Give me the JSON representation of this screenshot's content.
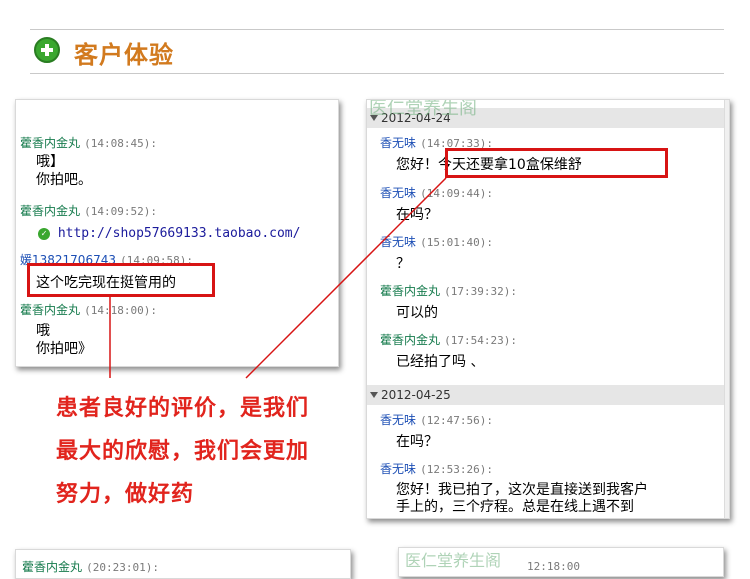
{
  "header": {
    "title": "客户体验",
    "icon": "plus-icon"
  },
  "left_shot": {
    "entries": [
      {
        "sender": "藿香内金丸",
        "time": "(14:08:45):",
        "lines": [
          "哦】",
          "你拍吧。"
        ]
      },
      {
        "sender": "藿香内金丸",
        "time": "(14:09:52):",
        "link": "http://shop57669133.taobao.com/"
      },
      {
        "sender": "媛13821706743",
        "time": "(14:09:58):",
        "lines": [
          "这个吃完现在挺管用的"
        ]
      },
      {
        "sender": "藿香内金丸",
        "time": "(14:18:00):",
        "lines": [
          "哦",
          "你拍吧》"
        ]
      }
    ]
  },
  "right_shot": {
    "watermark": "医仁堂养生阁",
    "date1": "2012-04-24",
    "entries1": [
      {
        "sender": "香无味",
        "time": "(14:07:33):",
        "line": "您好！今天还要拿10盒保维舒"
      },
      {
        "sender": "香无味",
        "time": "(14:09:44):",
        "line": "在吗？"
      },
      {
        "sender": "香无味",
        "time": "(15:01:40):",
        "line": "？"
      },
      {
        "sender": "藿香内金丸",
        "time": "(17:39:32):",
        "line": "可以的"
      },
      {
        "sender": "藿香内金丸",
        "time": "(17:54:23):",
        "line": "已经拍了吗 、"
      }
    ],
    "date2": "2012-04-25",
    "entries2": [
      {
        "sender": "香无味",
        "time": "(12:47:56):",
        "line": "在吗？"
      },
      {
        "sender": "香无味",
        "time": "(12:53:26):",
        "lines": [
          "您好！我已拍了，这次是直接送到我客户",
          "手上的，三个疗程。总是在线上遇不到"
        ]
      }
    ]
  },
  "caption": {
    "lines": [
      "患者良好的评价，是我们",
      "最大的欣慰，我们会更加",
      "努力，做好药"
    ]
  },
  "bottom_left": {
    "sender": "藿香内金丸",
    "time": "(20:23:01):"
  },
  "bottom_right": {
    "watermark": "医仁堂养生阁",
    "time": "12:18:00"
  },
  "colors": {
    "accent_red": "#d71414",
    "caption_red": "#e1241d",
    "sender_green": "#167b4d",
    "title_orange": "#d27a1e"
  }
}
